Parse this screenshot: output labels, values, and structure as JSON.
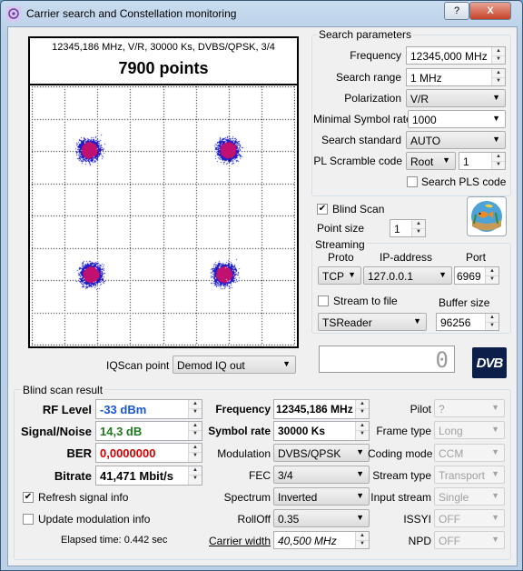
{
  "window": {
    "title": "Carrier search and Constellation monitoring",
    "help_label": "?",
    "close_label": "X"
  },
  "constellation": {
    "header": "12345,186 MHz, V/R, 30000 Ks, DVBS/QPSK, 3/4",
    "points_label": "7900 points"
  },
  "search": {
    "group_title": "Search parameters",
    "frequency_label": "Frequency",
    "frequency_value": "12345,000 MHz",
    "range_label": "Search range",
    "range_value": "1 MHz",
    "polarization_label": "Polarization",
    "polarization_value": "V/R",
    "symbol_rate_label": "Minimal Symbol rate",
    "symbol_rate_value": "1000",
    "standard_label": "Search standard",
    "standard_value": "AUTO",
    "pl_label": "PL Scramble code",
    "pl_mode": "Root",
    "pl_value": "1",
    "pls_label": "Search PLS code"
  },
  "blind": {
    "label": "Blind Scan",
    "checked": true,
    "point_size_label": "Point size",
    "point_size_value": "1"
  },
  "streaming": {
    "group_title": "Streaming",
    "proto_label": "Proto",
    "proto_value": "TCP",
    "ip_label": "IP-address",
    "ip_value": "127.0.0.1",
    "port_label": "Port",
    "port_value": "6969",
    "stream_file_label": "Stream to file",
    "buffer_label": "Buffer size",
    "reader_value": "TSReader",
    "buffer_value": "96256"
  },
  "iq": {
    "label": "IQScan point",
    "value": "Demod IQ out"
  },
  "lcd_value": "0",
  "dvb_logo": "DVB",
  "result": {
    "group_title": "Blind scan result",
    "rf_label": "RF Level",
    "rf_value": "-33 dBm",
    "sn_label": "Signal/Noise",
    "sn_value": "14,3 dB",
    "ber_label": "BER",
    "ber_value": "0,0000000",
    "bitrate_label": "Bitrate",
    "bitrate_value": "41,471 Mbit/s",
    "frequency_label": "Frequency",
    "frequency_value": "12345,186 MHz",
    "symbol_rate_label": "Symbol rate",
    "symbol_rate_value": "30000 Ks",
    "modulation_label": "Modulation",
    "modulation_value": "DVBS/QPSK",
    "fec_label": "FEC",
    "fec_value": "3/4",
    "spectrum_label": "Spectrum",
    "spectrum_value": "Inverted",
    "rolloff_label": "RollOff",
    "rolloff_value": "0.35",
    "carrier_width_label": "Carrier width",
    "carrier_width_value": "40,500 MHz",
    "pilot_label": "Pilot",
    "pilot_value": "?",
    "frame_type_label": "Frame type",
    "frame_type_value": "Long",
    "coding_mode_label": "Coding mode",
    "coding_mode_value": "CCM",
    "stream_type_label": "Stream type",
    "stream_type_value": "Transport",
    "input_stream_label": "Input stream",
    "input_stream_value": "Single",
    "issyi_label": "ISSYI",
    "issyi_value": "OFF",
    "npd_label": "NPD",
    "npd_value": "OFF",
    "refresh_label": "Refresh signal info",
    "update_label": "Update modulation info",
    "elapsed_label": "Elapsed time: 0.442 sec"
  },
  "colors": {
    "rf": "#1a57d6",
    "sn": "#1f7a1f",
    "ber": "#d40000",
    "points": "#1a1acc",
    "points_center": "#c01070"
  }
}
